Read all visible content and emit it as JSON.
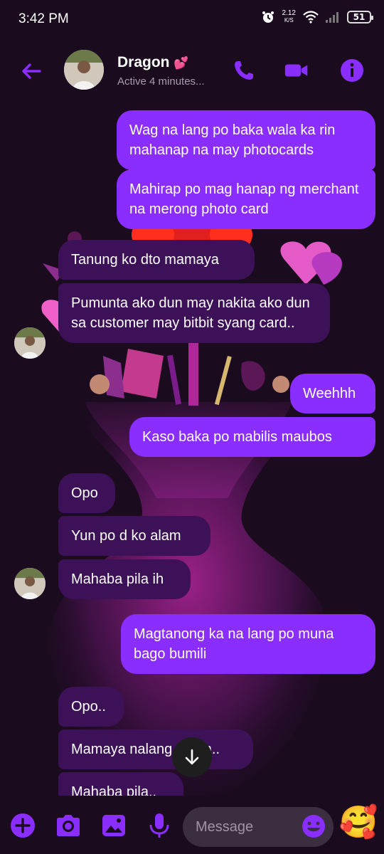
{
  "status_bar": {
    "time": "3:42 PM",
    "net_speed_value": "2.12",
    "net_speed_unit": "K/S",
    "battery": "51"
  },
  "header": {
    "contact_name": "Dragon",
    "contact_emoji": "💕",
    "status": "Active 4 minutes..."
  },
  "messages": [
    {
      "dir": "out",
      "text": "Wag na lang po baka wala ka rin mahanap na may photocards"
    },
    {
      "dir": "out",
      "text": "Mahirap po mag hanap ng merchant na merong photo card"
    },
    {
      "dir": "in",
      "text": "Tanung ko dto mamaya"
    },
    {
      "dir": "in",
      "text": "Pumunta ako dun may nakita ako dun sa customer may bitbit syang card.."
    },
    {
      "dir": "out",
      "text": "Weehhh"
    },
    {
      "dir": "out",
      "text": "Kaso baka po mabilis maubos"
    },
    {
      "dir": "in",
      "text": "Opo"
    },
    {
      "dir": "in",
      "text": "Yun po d ko alam"
    },
    {
      "dir": "in",
      "text": "Mahaba pila ih"
    },
    {
      "dir": "out",
      "text": "Magtanong ka na lang po muna bago bumili"
    },
    {
      "dir": "in",
      "text": "Opo.."
    },
    {
      "dir": "in",
      "text": "Mamaya nalang po ah.."
    },
    {
      "dir": "in",
      "text": "Mahaba pila.."
    }
  ],
  "composer": {
    "placeholder": "Message",
    "quick_reaction_emoji": "🥰"
  },
  "colors": {
    "accent": "#8a2dff",
    "outgoing_bubble": "#8a2dff",
    "incoming_bubble": "#3d1157",
    "background": "#1a0b1e"
  },
  "icons": [
    "back-arrow-icon",
    "phone-icon",
    "video-camera-icon",
    "info-icon",
    "plus-icon",
    "camera-icon",
    "image-icon",
    "microphone-icon",
    "emoji-icon",
    "arrow-down-icon",
    "alarm-icon",
    "wifi-icon",
    "signal-icon"
  ]
}
